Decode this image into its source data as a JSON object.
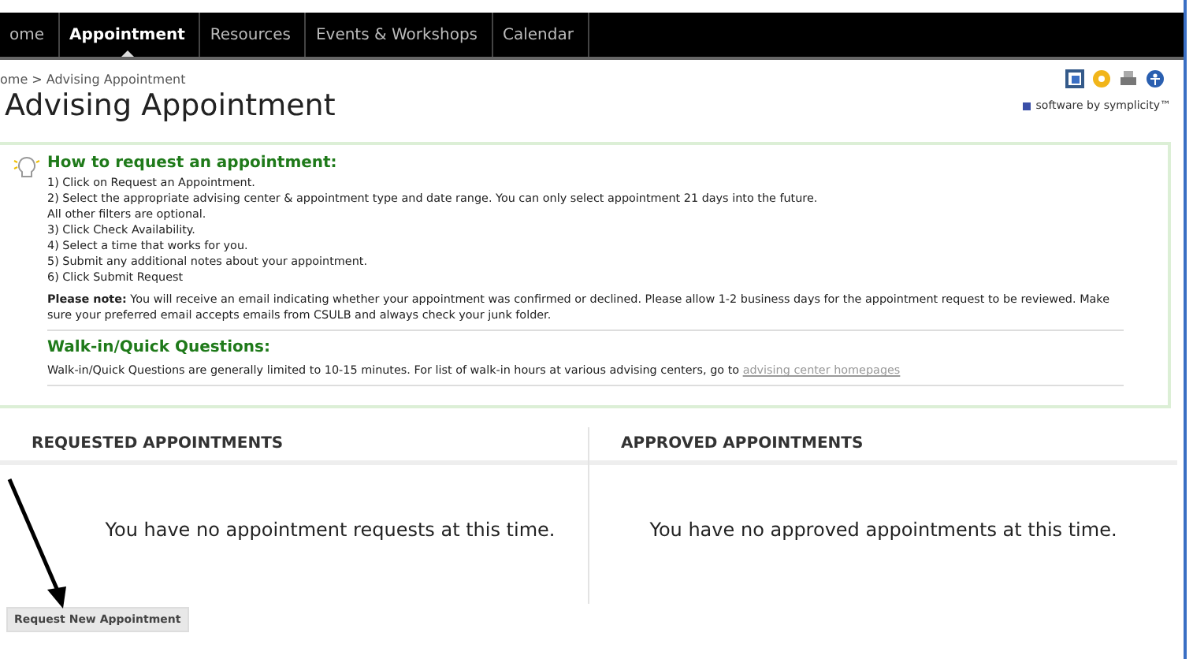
{
  "nav": [
    {
      "label": "ome",
      "selected": false
    },
    {
      "label": "Appointment",
      "selected": true
    },
    {
      "label": "Resources",
      "selected": false
    },
    {
      "label": "Events & Workshops",
      "selected": false
    },
    {
      "label": "Calendar",
      "selected": false
    }
  ],
  "breadcrumb": "ome > Advising Appointment",
  "title": "Advising Appointment",
  "vendor": "software by symplicity™",
  "info": {
    "heading": "How to request an appointment:",
    "steps": [
      "1) Click on Request an Appointment.",
      "2) Select the appropriate advising center & appointment type and date range. You can only select appointment 21 days into the future.",
      "All other filters are optional.",
      "3) Click Check Availability.",
      "4) Select a time that works for you.",
      "5) Submit any additional notes about your appointment.",
      "6) Click Submit Request"
    ],
    "note": "**Please note:** You will receive an email indicating whether your appointment was confirmed or declined. Please allow 1-2 business days for the appointment request to be reviewed. Make sure your preferred email accepts emails from CSULB and always check your junk folder.",
    "walkin_heading": "Walk-in/Quick Questions:",
    "walkin_text": "Walk-in/Quick Questions are generally limited to 10-15 minutes. For list of walk-in hours at various advising centers, go to",
    "walkin_link": "advising center homepages"
  },
  "sections": [
    {
      "title": "REQUESTED APPOINTMENTS",
      "message": "You have no appointment requests at this time."
    },
    {
      "title": "APPROVED APPOINTMENTS",
      "message": "You have no approved appointments at this time."
    }
  ],
  "button": "Request New Appointment"
}
